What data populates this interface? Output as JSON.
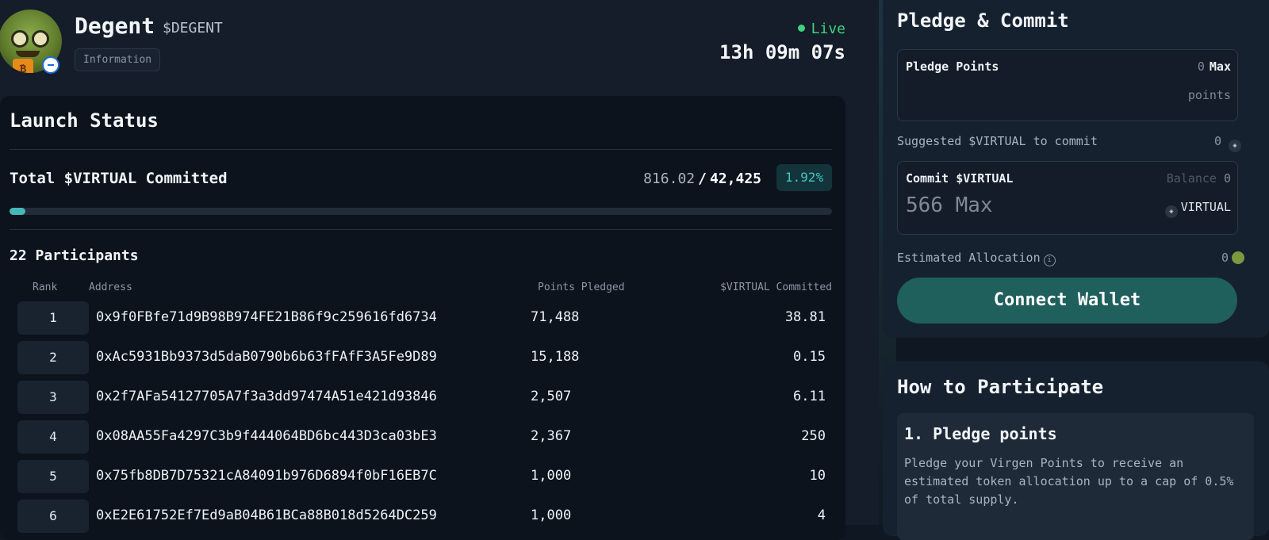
{
  "token": {
    "name": "Degent",
    "ticker": "$DEGENT",
    "info_tag": "Information",
    "status": "Live",
    "countdown": "13h 09m 07s",
    "avatar_icon": "frog-avatar-icon",
    "chain_icon": "base-chain-icon"
  },
  "launch": {
    "title": "Launch Status",
    "committed_label": "Total $VIRTUAL Committed",
    "committed": "816.02",
    "separator": "/",
    "target": "42,425",
    "percent": "1.92%",
    "progress_fraction": 0.0192,
    "participants_label": "22 Participants",
    "columns": [
      "Rank",
      "Address",
      "Points Pledged",
      "$VIRTUAL Committed"
    ],
    "rows": [
      {
        "rank": "1",
        "address": "0x9f0FBfe71d9B98B974FE21B86f9c259616fd6734",
        "points": "71,488",
        "virtual": "38.81"
      },
      {
        "rank": "2",
        "address": "0xAc5931Bb9373d5daB0790b6b63fFAfF3A5Fe9D89",
        "points": "15,188",
        "virtual": "0.15"
      },
      {
        "rank": "3",
        "address": "0x2f7AFa54127705A7f3a3dd97474A51e421d93846",
        "points": "2,507",
        "virtual": "6.11"
      },
      {
        "rank": "4",
        "address": "0x08AA55Fa4297C3b9f444064BD6bc443D3ca03bE3",
        "points": "2,367",
        "virtual": "250"
      },
      {
        "rank": "5",
        "address": "0x75fb8DB7D75321cA84091b976D6894f0bF16EB7C",
        "points": "1,000",
        "virtual": "10"
      },
      {
        "rank": "6",
        "address": "0xE2E61752Ef7Ed9aB04B61BCa88B018d5264DC259",
        "points": "1,000",
        "virtual": "4"
      }
    ]
  },
  "pledge": {
    "title": "Pledge & Commit",
    "pledge_points_label": "Pledge Points",
    "pledge_points_value": "0",
    "max_label": "Max",
    "points_unit": "points",
    "suggested_label": "Suggested $VIRTUAL to commit",
    "suggested_value": "0",
    "commit_label": "Commit $VIRTUAL",
    "balance_label": "Balance",
    "balance_value": "0",
    "commit_input": "566 Max",
    "commit_unit": "VIRTUAL",
    "estimated_label": "Estimated Allocation",
    "estimated_value": "0",
    "connect_button": "Connect Wallet"
  },
  "how": {
    "title": "How to Participate",
    "step1_title": "1. Pledge points",
    "step1_text": "Pledge your Virgen Points to receive an estimated token allocation up to a cap of 0.5% of total supply."
  },
  "colors": {
    "accent": "#44b8b8",
    "live": "#3fd27a",
    "button": "#1f5f5c",
    "panel": "#0c131d",
    "card": "#162130"
  }
}
